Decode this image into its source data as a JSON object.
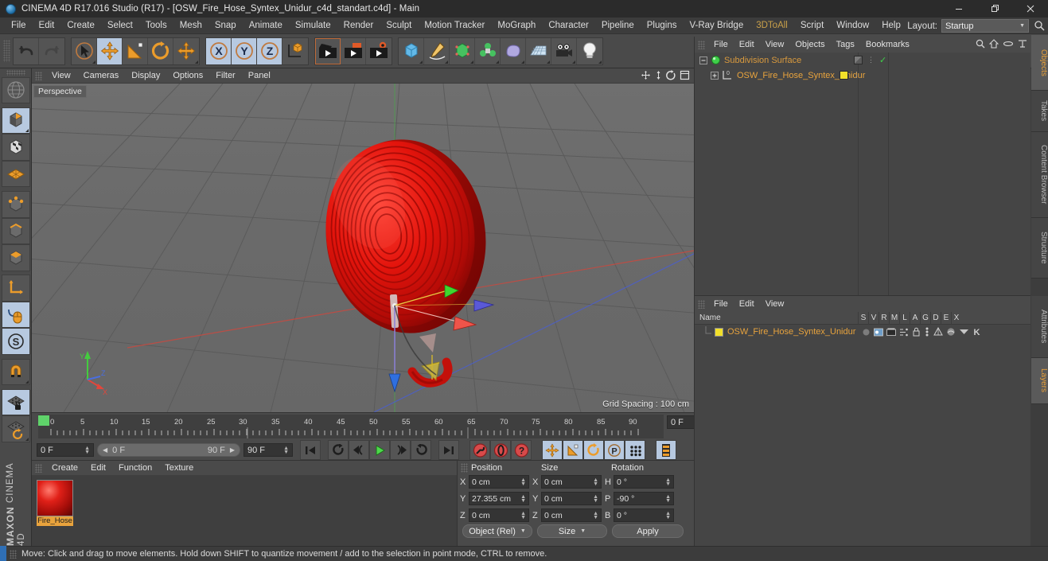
{
  "window": {
    "title": "CINEMA 4D R17.016 Studio (R17) - [OSW_Fire_Hose_Syntex_Unidur_c4d_standart.c4d] - Main",
    "minimize": "─",
    "maximize": "❐",
    "close": "✕"
  },
  "menubar": {
    "items": [
      "File",
      "Edit",
      "Create",
      "Select",
      "Tools",
      "Mesh",
      "Snap",
      "Animate",
      "Simulate",
      "Render",
      "Sculpt",
      "Motion Tracker",
      "MoGraph",
      "Character",
      "Pipeline",
      "Plugins",
      "V-Ray Bridge",
      "3DToAll",
      "Script",
      "Window",
      "Help"
    ],
    "layout_label": "Layout:",
    "layout_value": "Startup",
    "search_icon": "search-icon"
  },
  "toolbar": {
    "groups": [
      {
        "name": "history",
        "buttons": [
          {
            "id": "undo",
            "icon": "undo-icon",
            "state": "normal"
          },
          {
            "id": "redo",
            "icon": "redo-icon",
            "state": "disabled"
          }
        ]
      },
      {
        "name": "tools",
        "buttons": [
          {
            "id": "select",
            "icon": "live-selection-icon",
            "state": "normal"
          },
          {
            "id": "move",
            "icon": "move-icon",
            "state": "active"
          },
          {
            "id": "scale",
            "icon": "scale-icon",
            "state": "normal"
          },
          {
            "id": "rotate",
            "icon": "rotate-icon",
            "state": "normal"
          },
          {
            "id": "dynamic-place",
            "icon": "dynamic-place-icon",
            "state": "normal"
          }
        ]
      },
      {
        "name": "axes",
        "buttons": [
          {
            "id": "axis-x",
            "icon": "x-axis-icon",
            "state": "active",
            "label": "X"
          },
          {
            "id": "axis-y",
            "icon": "y-axis-icon",
            "state": "active",
            "label": "Y"
          },
          {
            "id": "axis-z",
            "icon": "z-axis-icon",
            "state": "active",
            "label": "Z"
          },
          {
            "id": "world-object",
            "icon": "world-coordinate-icon",
            "state": "normal"
          }
        ]
      },
      {
        "name": "render",
        "buttons": [
          {
            "id": "render-view",
            "icon": "render-view-icon",
            "state": "selected"
          },
          {
            "id": "render-region",
            "icon": "render-region-icon",
            "state": "normal"
          },
          {
            "id": "render-settings",
            "icon": "render-settings-icon",
            "state": "normal"
          }
        ]
      },
      {
        "name": "objects",
        "buttons": [
          {
            "id": "cube",
            "icon": "cube-primitive-icon",
            "state": "normal"
          },
          {
            "id": "spline",
            "icon": "pen-spline-icon",
            "state": "normal"
          },
          {
            "id": "generator",
            "icon": "nurbs-generator-icon",
            "state": "normal"
          },
          {
            "id": "deformer",
            "icon": "deformer-icon",
            "state": "normal"
          },
          {
            "id": "scene",
            "icon": "scene-object-icon",
            "state": "normal"
          },
          {
            "id": "floor",
            "icon": "floor-icon",
            "state": "normal"
          },
          {
            "id": "camera",
            "icon": "camera-icon",
            "state": "normal"
          },
          {
            "id": "light",
            "icon": "light-bulb-icon",
            "state": "normal"
          }
        ]
      }
    ]
  },
  "lefttoolbar": {
    "buttons": [
      {
        "id": "make-editable",
        "icon": "make-editable-icon",
        "state": "normal"
      },
      {
        "id": "model-mode",
        "icon": "model-mode-icon",
        "state": "active"
      },
      {
        "id": "texture-mode",
        "icon": "texture-mode-icon",
        "state": "normal"
      },
      {
        "id": "workplane",
        "icon": "workplane-icon",
        "state": "normal"
      },
      {
        "id": "points-mode",
        "icon": "points-mode-icon",
        "state": "normal"
      },
      {
        "id": "edges-mode",
        "icon": "edges-mode-icon",
        "state": "normal"
      },
      {
        "id": "polygons-mode",
        "icon": "polygons-mode-icon",
        "state": "normal"
      },
      {
        "id": "axis-modify",
        "icon": "axis-modify-icon",
        "state": "normal"
      },
      {
        "id": "enable-axis",
        "icon": "mouse-axis-icon",
        "state": "active"
      },
      {
        "id": "soft-selection",
        "icon": "soft-selection-icon",
        "state": "active"
      },
      {
        "id": "snap",
        "icon": "magnet-snap-icon",
        "state": "normal"
      },
      {
        "id": "workplane-lock",
        "icon": "workplane-lock-icon",
        "state": "active"
      },
      {
        "id": "workplane-rotate",
        "icon": "workplane-rotate-icon",
        "state": "normal"
      }
    ],
    "brand_top": "MAXON",
    "brand_bottom": "CINEMA 4D"
  },
  "viewport": {
    "menu": [
      "View",
      "Cameras",
      "Display",
      "Options",
      "Filter",
      "Panel"
    ],
    "label": "Perspective",
    "grid_spacing": "Grid Spacing : 100 cm",
    "icons": [
      "pan-icon",
      "zoom-icon",
      "rotate-view-icon",
      "maximize-view-icon"
    ]
  },
  "timeline": {
    "ticks": [
      "0",
      "5",
      "10",
      "15",
      "20",
      "25",
      "30",
      "35",
      "40",
      "45",
      "50",
      "55",
      "60",
      "65",
      "70",
      "75",
      "80",
      "85",
      "90"
    ],
    "current_frame_field": "0 F",
    "start_field": "0 F",
    "range_start": "0 F",
    "range_end": "90 F",
    "end_field": "90 F",
    "fps_field": "0 F",
    "playback_buttons": [
      {
        "id": "goto-start",
        "icon": "go-to-start-icon"
      },
      {
        "id": "play-reverse-loop",
        "icon": "loop-icon"
      },
      {
        "id": "prev-frame",
        "icon": "previous-frame-icon"
      },
      {
        "id": "play",
        "icon": "play-icon"
      },
      {
        "id": "next-frame",
        "icon": "next-frame-icon"
      },
      {
        "id": "play-forward-loop",
        "icon": "forward-loop-icon"
      },
      {
        "id": "goto-end",
        "icon": "go-to-end-icon"
      }
    ],
    "record_buttons": [
      {
        "id": "record-keyframe",
        "icon": "record-key-icon"
      },
      {
        "id": "autokey",
        "icon": "autokeying-icon"
      },
      {
        "id": "keyframe-selection",
        "icon": "keyframe-selection-icon"
      }
    ],
    "key_filter_buttons": [
      {
        "id": "key-position",
        "icon": "position-key-icon",
        "state": "active"
      },
      {
        "id": "key-scale",
        "icon": "scale-key-icon",
        "state": "active"
      },
      {
        "id": "key-rotation",
        "icon": "rotation-key-icon",
        "state": "active"
      },
      {
        "id": "key-param",
        "icon": "parameter-key-icon",
        "state": "active"
      },
      {
        "id": "key-pla",
        "icon": "point-level-animation-icon",
        "state": "active"
      }
    ],
    "extra_button": {
      "id": "timeline-toggle",
      "icon": "timeline-panel-icon",
      "state": "active"
    }
  },
  "material_manager": {
    "menu": [
      "Create",
      "Edit",
      "Function",
      "Texture"
    ],
    "materials": [
      {
        "name": "Fire_Hose",
        "swatch_color": "#d8120d",
        "selected": true
      }
    ]
  },
  "coordinates": {
    "headers": [
      "Position",
      "Size",
      "Rotation"
    ],
    "rows": [
      {
        "pos_label": "X",
        "pos_value": "0 cm",
        "size_label": "X",
        "size_value": "0 cm",
        "rot_label": "H",
        "rot_value": "0 °"
      },
      {
        "pos_label": "Y",
        "pos_value": "27.355 cm",
        "size_label": "Y",
        "size_value": "0 cm",
        "rot_label": "P",
        "rot_value": "-90 °"
      },
      {
        "pos_label": "Z",
        "pos_value": "0 cm",
        "size_label": "Z",
        "size_value": "0 cm",
        "rot_label": "B",
        "rot_value": "0 °"
      }
    ],
    "mode_dropdown": "Object (Rel)",
    "size_dropdown": "Size",
    "apply_button": "Apply"
  },
  "object_manager": {
    "menu": [
      "File",
      "Edit",
      "View",
      "Objects",
      "Tags",
      "Bookmarks"
    ],
    "icons": [
      "search-icon",
      "home-icon",
      "ellipsis-icon",
      "expand-icon"
    ],
    "tree": [
      {
        "name": "Subdivision Surface",
        "icon": "subdivision-surface-icon",
        "color": "#d99a3e",
        "depth": 0,
        "tag_color": "#6e6e6e",
        "check": "✓"
      },
      {
        "name": "OSW_Fire_Hose_Syntex_Unidur",
        "icon": "polygon-object-icon",
        "color": "#e8a33d",
        "depth": 1,
        "tag_color": "#f2e02a",
        "check": ""
      }
    ]
  },
  "attributes_manager": {
    "menu": [
      "File",
      "Edit",
      "View"
    ],
    "columns": [
      "Name",
      "S",
      "V",
      "R",
      "M",
      "L",
      "A",
      "G",
      "D",
      "E",
      "X"
    ],
    "rows": [
      {
        "name": "OSW_Fire_Hose_Syntex_Unidur",
        "swatch": "#f2e02a"
      }
    ]
  },
  "right_tabs": {
    "top": [
      {
        "label": "Objects",
        "active": true
      },
      {
        "label": "Takes",
        "active": false
      },
      {
        "label": "Content Browser",
        "active": false
      },
      {
        "label": "Structure",
        "active": false
      }
    ],
    "bottom": [
      {
        "label": "Attributes",
        "active": false
      },
      {
        "label": "Layers",
        "active": true
      }
    ]
  },
  "statusbar": {
    "message": "Move: Click and drag to move elements. Hold down SHIFT to quantize movement / add to the selection in point mode, CTRL to remove."
  },
  "colors": {
    "accent_orange": "#e8a33d",
    "model_red": "#e01810",
    "axis_x": "#e74c3c",
    "axis_y": "#53d14a",
    "axis_z": "#4a6ee0",
    "highlight_blue": "#b7c9e0"
  }
}
